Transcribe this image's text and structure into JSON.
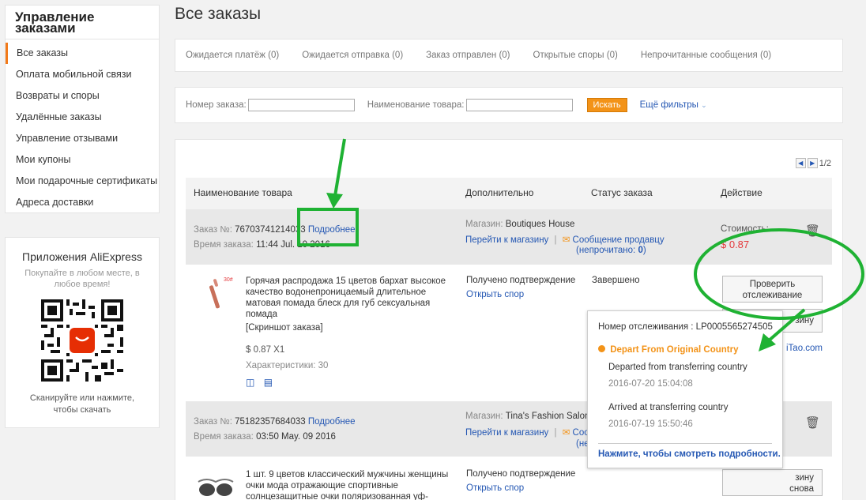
{
  "sidebar": {
    "title_line1": "Управление",
    "title_line2": "заказами",
    "items": [
      {
        "label": "Все заказы"
      },
      {
        "label": "Оплата мобильной связи"
      },
      {
        "label": "Возвраты и споры"
      },
      {
        "label": "Удалённые заказы"
      },
      {
        "label": "Управление отзывами"
      },
      {
        "label": "Мои купоны"
      },
      {
        "label": "Мои подарочные сертификаты"
      },
      {
        "label": "Адреса доставки"
      }
    ]
  },
  "apps": {
    "title": "Приложения AliExpress",
    "subtitle": "Покупайте в любом месте, в любое время!",
    "footer_line1": "Сканируйте или нажмите,",
    "footer_line2": "чтобы скачать",
    "qr_logo_text": "AliExpress"
  },
  "main": {
    "title": "Все заказы",
    "tabs": [
      {
        "label": "Ожидается платёж (0)"
      },
      {
        "label": "Ожидается отправка (0)"
      },
      {
        "label": "Заказ отправлен (0)"
      },
      {
        "label": "Открытые споры (0)"
      },
      {
        "label": "Непрочитанные сообщения (0)"
      }
    ],
    "filters": {
      "order_no_label": "Номер заказа:",
      "order_no_value": "",
      "product_label": "Наименование товара:",
      "product_value": "",
      "search_btn": "Искать",
      "more_filters": "Ещё фильтры"
    },
    "pager": {
      "text": "1/2"
    },
    "table_headers": {
      "product": "Наименование товара",
      "extra": "Дополнительно",
      "status": "Статус заказа",
      "action": "Действие"
    },
    "orders": [
      {
        "order_label": "Заказ №:",
        "order_no": "76703741214033",
        "details_link": "Подробнее",
        "time_label": "Время заказа:",
        "time": "11:44 Jul. 10 2016",
        "store_label": "Магазин:",
        "store": "Boutiques House",
        "store_link": "Перейти к магазину",
        "message_link": "Сообщение продавцу",
        "unread_prefix": "(непрочитано: ",
        "unread_count": "0",
        "unread_suffix": ")",
        "price_label": "Стоимость:",
        "price": "$ 0.87",
        "product_title": "Горячая распродажа 15 цветов бархат высокое качество водонепроницаемый длительное матовая помада блеск для губ сексуальная помада",
        "snapshot": "[Скриншот заказа]",
        "qty": "$ 0.87 X1",
        "specs": "Характеристики: 30",
        "confirm": "Получено подтверждение",
        "dispute_link": "Открыть спор",
        "status": "Завершено",
        "track_btn_line1": "Проверить",
        "track_btn_line2": "отслеживание",
        "cart_btn_partial": "зину",
        "side_link_partial": "iTao.com",
        "thumb_label": "30#"
      },
      {
        "order_label": "Заказ №:",
        "order_no": "75182357684033",
        "details_link": "Подробнее",
        "time_label": "Время заказа:",
        "time": "03:50 May. 09 2016",
        "store_label": "Магазин:",
        "store": "Tina's Fashion Salon",
        "store_link": "Перейти к магазину",
        "message_link_partial": "Соо",
        "message_link_partial2": "(не",
        "product_title": "1 шт. 9 цветов классический мужчины женщины очки мода отражающие спортивные солнцезащитные очки поляризованная уф-",
        "confirm": "Получено подтверждение",
        "dispute_link": "Открыть спор",
        "cart_btn_line1": "зину",
        "cart_btn_line2": "снова"
      }
    ]
  },
  "tracking_popup": {
    "number_label": "Номер отслеживания : LP0005565274505",
    "event_header": "Depart From Original Country",
    "events": [
      {
        "desc": "Departed from transferring country",
        "time": "2016-07-20 15:04:08"
      },
      {
        "desc": "Arrived at transferring country",
        "time": "2016-07-19 15:50:46"
      }
    ],
    "more_link": "Нажмите, чтобы смотреть подробности."
  },
  "colors": {
    "accent_orange": "#f39318",
    "link_blue": "#2457b3",
    "price_red": "#e4393c",
    "annotation_green": "#1fb233"
  }
}
